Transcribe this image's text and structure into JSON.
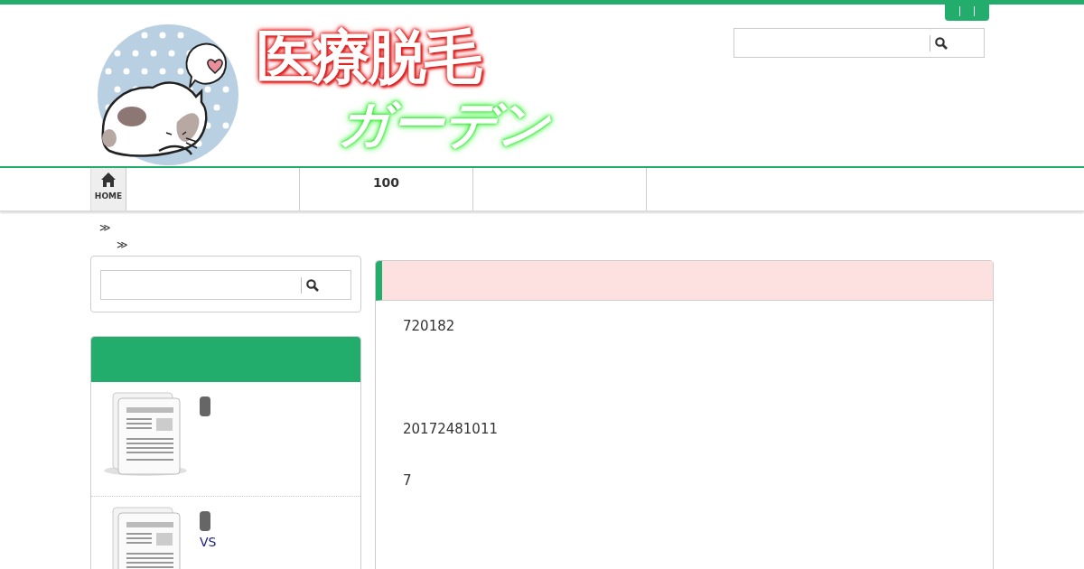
{
  "header": {
    "logo": {
      "line_1": "医療脱毛",
      "line_2": "ガーデン"
    }
  },
  "nav": [
    {
      "kind": "home",
      "label": "HOME"
    },
    {
      "kind": "link"
    },
    {
      "kind": "link",
      "label": "100"
    },
    {
      "kind": "link"
    },
    {
      "kind": "link"
    }
  ],
  "breadcrumb": [
    "≫",
    "≫"
  ],
  "sidebar": {
    "articles": [
      {
        "kind": "article"
      },
      {
        "kind": "article",
        "link": "VS"
      }
    ]
  },
  "main": {
    "paragraphs": [
      "720182",
      "20172481011",
      "7"
    ]
  }
}
